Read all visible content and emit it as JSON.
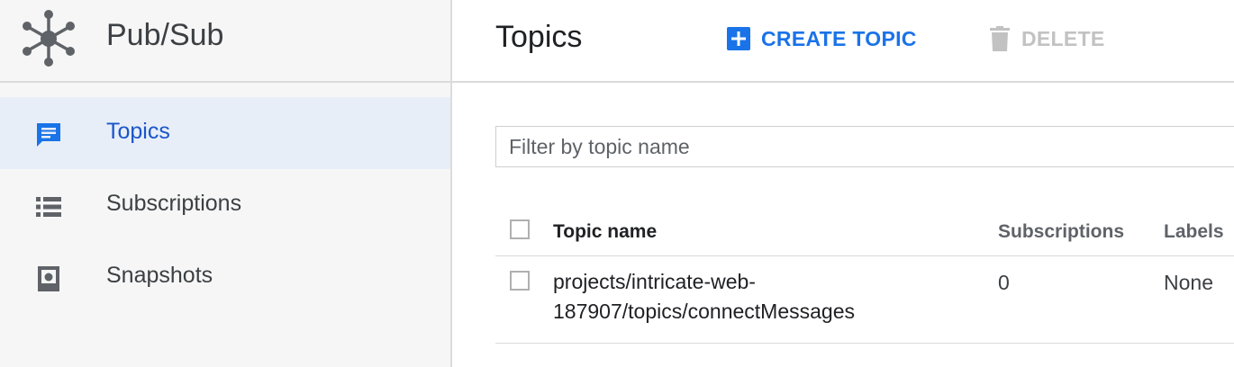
{
  "app": {
    "title": "Pub/Sub",
    "logo_icon": "pubsub-hub-icon"
  },
  "sidebar": {
    "items": [
      {
        "label": "Topics",
        "icon": "topics-chat-icon",
        "active": true
      },
      {
        "label": "Subscriptions",
        "icon": "list-icon",
        "active": false
      },
      {
        "label": "Snapshots",
        "icon": "snapshot-icon",
        "active": false
      }
    ]
  },
  "header": {
    "title": "Topics",
    "create_label": "CREATE TOPIC",
    "delete_label": "DELETE"
  },
  "filter": {
    "placeholder": "Filter by topic name",
    "value": ""
  },
  "table": {
    "columns": [
      "Topic name",
      "Subscriptions",
      "Labels"
    ],
    "rows": [
      {
        "name_line1": "projects/intricate-web-",
        "name_line2": "187907/topics/connectMessages",
        "subscriptions": "0",
        "labels": "None"
      }
    ]
  },
  "colors": {
    "accent": "#1a73e8",
    "active_bg": "#e8eef8",
    "sidebar_bg": "#f6f6f6",
    "disabled": "#c2c2c2"
  }
}
